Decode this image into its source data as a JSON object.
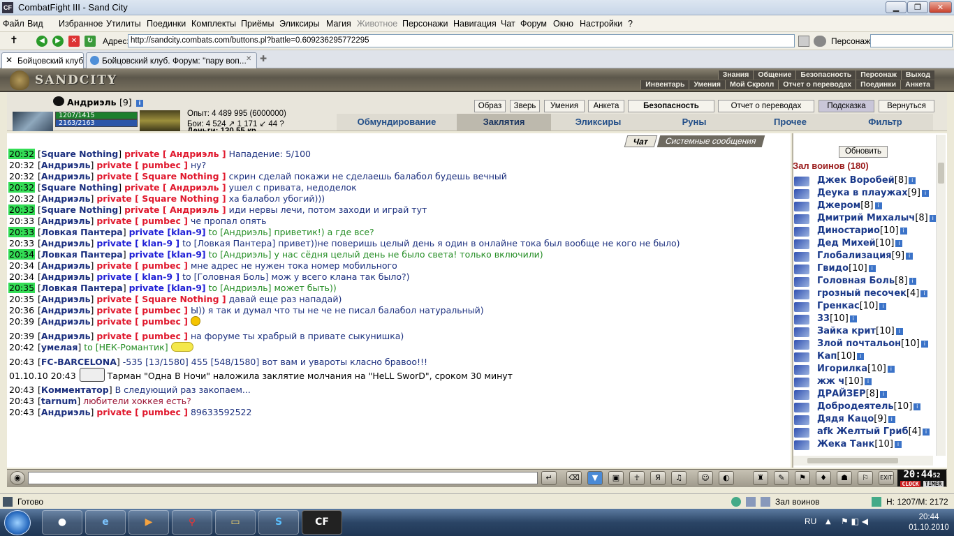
{
  "window": {
    "title": "CombatFight III - Sand City",
    "app_icon": "CF"
  },
  "menu": [
    "Файл",
    "Вид",
    "Избранное",
    "Утилиты",
    "Поединки",
    "Комплекты",
    "Приёмы",
    "Эликсиры",
    "Магия",
    "Животное",
    "Персонажи",
    "Навигация",
    "Чат",
    "Форум",
    "Окно",
    "Настройки",
    "?"
  ],
  "address": {
    "label": "Адрес:",
    "url": "http://sandcity.combats.com/buttons.pl?battle=0.609236295772295",
    "persona_label": "Персонаж:"
  },
  "tabs": [
    {
      "label": "Бойцовский клуб"
    },
    {
      "label": "Бойцовский клуб. Форум: \"пару воп..."
    }
  ],
  "game_header": {
    "logo": "SANDCITY",
    "nav_top": [
      "Знания",
      "Общение",
      "Безопасность",
      "Персонаж",
      "Выход"
    ],
    "nav_bottom": [
      "Инвентарь",
      "Умения",
      "Мой Скролл",
      "Отчет о переводах",
      "Поединки",
      "Анкета"
    ]
  },
  "character": {
    "name": "Андриэль",
    "level": "[9]",
    "hp": "1207/1415",
    "mana": "2163/2163",
    "exp": "Опыт: 4 489 995 (6000000)",
    "battles": "Бои: 4 524 ↗ 1 171 ↙ 44 ?",
    "money": "Деньги: 130.55 кр."
  },
  "char_buttons": [
    "Образ",
    "Зверь",
    "Умения",
    "Анкета",
    "Безопасность",
    "Отчет о переводах",
    "Подсказка",
    "Вернуться"
  ],
  "game_tabs": [
    "Обмундирование",
    "Заклятия",
    "Эликсиры",
    "Руны",
    "Прочее",
    "Фильтр"
  ],
  "chat_tabs": [
    "Чат",
    "Системные сообщения"
  ],
  "chat": [
    {
      "t": "20:32",
      "hl": true,
      "from": "Square Nothing",
      "priv": "private [ Андриэль ]",
      "msg": "Нападение: 5/100"
    },
    {
      "t": "20:32",
      "hl": false,
      "from": "Андриэль",
      "priv": "private [ pumbec ]",
      "msg": "ну?"
    },
    {
      "t": "20:32",
      "hl": false,
      "from": "Андриэль",
      "priv": "private [ Square Nothing ]",
      "msg": "скрин сделай покажи не сделаешь балабол будешь вечный"
    },
    {
      "t": "20:32",
      "hl": true,
      "from": "Square Nothing",
      "priv": "private [ Андриэль ]",
      "msg": "ушел с привата, недоделок"
    },
    {
      "t": "20:32",
      "hl": false,
      "from": "Андриэль",
      "priv": "private [ Square Nothing ]",
      "msg": "ха балабол убогий)))"
    },
    {
      "t": "20:33",
      "hl": true,
      "from": "Square Nothing",
      "priv": "private [ Андриэль ]",
      "msg": "иди нервы лечи, потом заходи и играй тут"
    },
    {
      "t": "20:33",
      "hl": false,
      "from": "Андриэль",
      "priv": "private [ pumbec ]",
      "msg": "че пропал опять"
    },
    {
      "t": "20:33",
      "hl": true,
      "from": "Ловкая Пантера",
      "privb": "private [klan-9]",
      "to": "to [Андриэль]",
      "msg": "приветик!) а где все?",
      "grn": true
    },
    {
      "t": "20:33",
      "hl": false,
      "from": "Андриэль",
      "privb": "private [ klan-9 ]",
      "to": "to [Ловкая Пантера]",
      "msg": "привет))не поверишь целый день я один в онлайне тока был вообще не кого не было)"
    },
    {
      "t": "20:34",
      "hl": true,
      "from": "Ловкая Пантера",
      "privb": "private [klan-9]",
      "to": "to [Андриэль]",
      "msg": "у нас сёдня целый день не было света! только включили)",
      "grn": true
    },
    {
      "t": "20:34",
      "hl": false,
      "from": "Андриэль",
      "priv": "private [ pumbec ]",
      "msg": "мне адрес не нужен тока номер мобильного"
    },
    {
      "t": "20:34",
      "hl": false,
      "from": "Андриэль",
      "privb": "private [ klan-9 ]",
      "to": "to [Головная Боль]",
      "msg": "мож у всего клана так было?)"
    },
    {
      "t": "20:35",
      "hl": true,
      "from": "Ловкая Пантера",
      "privb": "private [klan-9]",
      "to": "to [Андриэль]",
      "msg": "может быть))",
      "grn": true
    },
    {
      "t": "20:35",
      "hl": false,
      "from": "Андриэль",
      "priv": "private [ Square Nothing ]",
      "msg": "давай еще раз нападай)"
    },
    {
      "t": "20:36",
      "hl": false,
      "from": "Андриэль",
      "priv": "private [ pumbec ]",
      "msg": "Ы)) я так и думал что ты не че не писал балабол натуральный)"
    },
    {
      "t": "20:39",
      "hl": false,
      "from": "Андриэль",
      "priv": "private [ pumbec ]",
      "msg": "",
      "smile": true
    },
    {
      "t": "20:39",
      "hl": false,
      "from": "Андриэль",
      "priv": "private [ pumbec ]",
      "msg": "на форуме ты храбрый в привате сыкунишка)"
    },
    {
      "t": "20:42",
      "hl": false,
      "from": "умелая",
      "to": "to [НЕК-Романтик]",
      "msg": "",
      "grn": true,
      "bee": true
    },
    {
      "t": "20:43",
      "hl": false,
      "from": "FC-BARCELONA",
      "msg": "-535 [13/1580] 455 [548/1580] вот вам и увароты класно бравоо!!!"
    },
    {
      "t": "01.10.10 20:43",
      "hl": false,
      "sys": true,
      "msg": "Тарман \"Одна В Ночи\" наложила заклятие молчания на \"HeLL SworD\", сроком 30 минут"
    },
    {
      "t": "20:43",
      "hl": false,
      "from": "Комментатор",
      "msg": "В следующий раз закопаем..."
    },
    {
      "t": "20:43",
      "hl": false,
      "from": "tarnum",
      "msg": "любители хоккея есть?",
      "dk": true
    },
    {
      "t": "20:43",
      "hl": false,
      "from": "Андриэль",
      "priv": "private [ pumbec ]",
      "msg": "89633592522"
    }
  ],
  "sidebar": {
    "refresh": "Обновить",
    "room": "Зал воинов (180)",
    "users": [
      {
        "name": "Джек Воробей",
        "lvl": "[8]"
      },
      {
        "name": "Деука в плаужах",
        "lvl": "[9]"
      },
      {
        "name": "Джером",
        "lvl": "[8]"
      },
      {
        "name": "Дмитрий Михалыч",
        "lvl": "[8]"
      },
      {
        "name": "Диностарио",
        "lvl": "[10]"
      },
      {
        "name": "Дед Михей",
        "lvl": "[10]"
      },
      {
        "name": "Глобализация",
        "lvl": "[9]"
      },
      {
        "name": "Гвидо",
        "lvl": "[10]"
      },
      {
        "name": "Головная Боль",
        "lvl": "[8]"
      },
      {
        "name": "грозный песочек",
        "lvl": "[4]"
      },
      {
        "name": "Гренкас",
        "lvl": "[10]"
      },
      {
        "name": "33",
        "lvl": "[10]"
      },
      {
        "name": "Зайка крит",
        "lvl": "[10]"
      },
      {
        "name": "Злой почтальон",
        "lvl": "[10]"
      },
      {
        "name": "Кап",
        "lvl": "[10]"
      },
      {
        "name": "Игорилка",
        "lvl": "[10]"
      },
      {
        "name": "жж ч",
        "lvl": "[10]"
      },
      {
        "name": "ДРАЙЗЕР",
        "lvl": "[8]"
      },
      {
        "name": "Добродеятель",
        "lvl": "[10]"
      },
      {
        "name": "Дядя Кацо",
        "lvl": "[9]"
      },
      {
        "name": "afk Желтый Гриб",
        "lvl": "[4]"
      },
      {
        "name": "Жека Танк",
        "lvl": "[10]"
      }
    ]
  },
  "clock": {
    "time": "20:44",
    "sec": "52",
    "label1": "CLOCK",
    "label2": "TIMER"
  },
  "status": {
    "left": "Готово",
    "room": "Зал воинов",
    "hp": "H: 1207/M: 2172"
  },
  "taskbar": {
    "lang": "RU",
    "time": "20:44",
    "date": "01.10.2010"
  }
}
